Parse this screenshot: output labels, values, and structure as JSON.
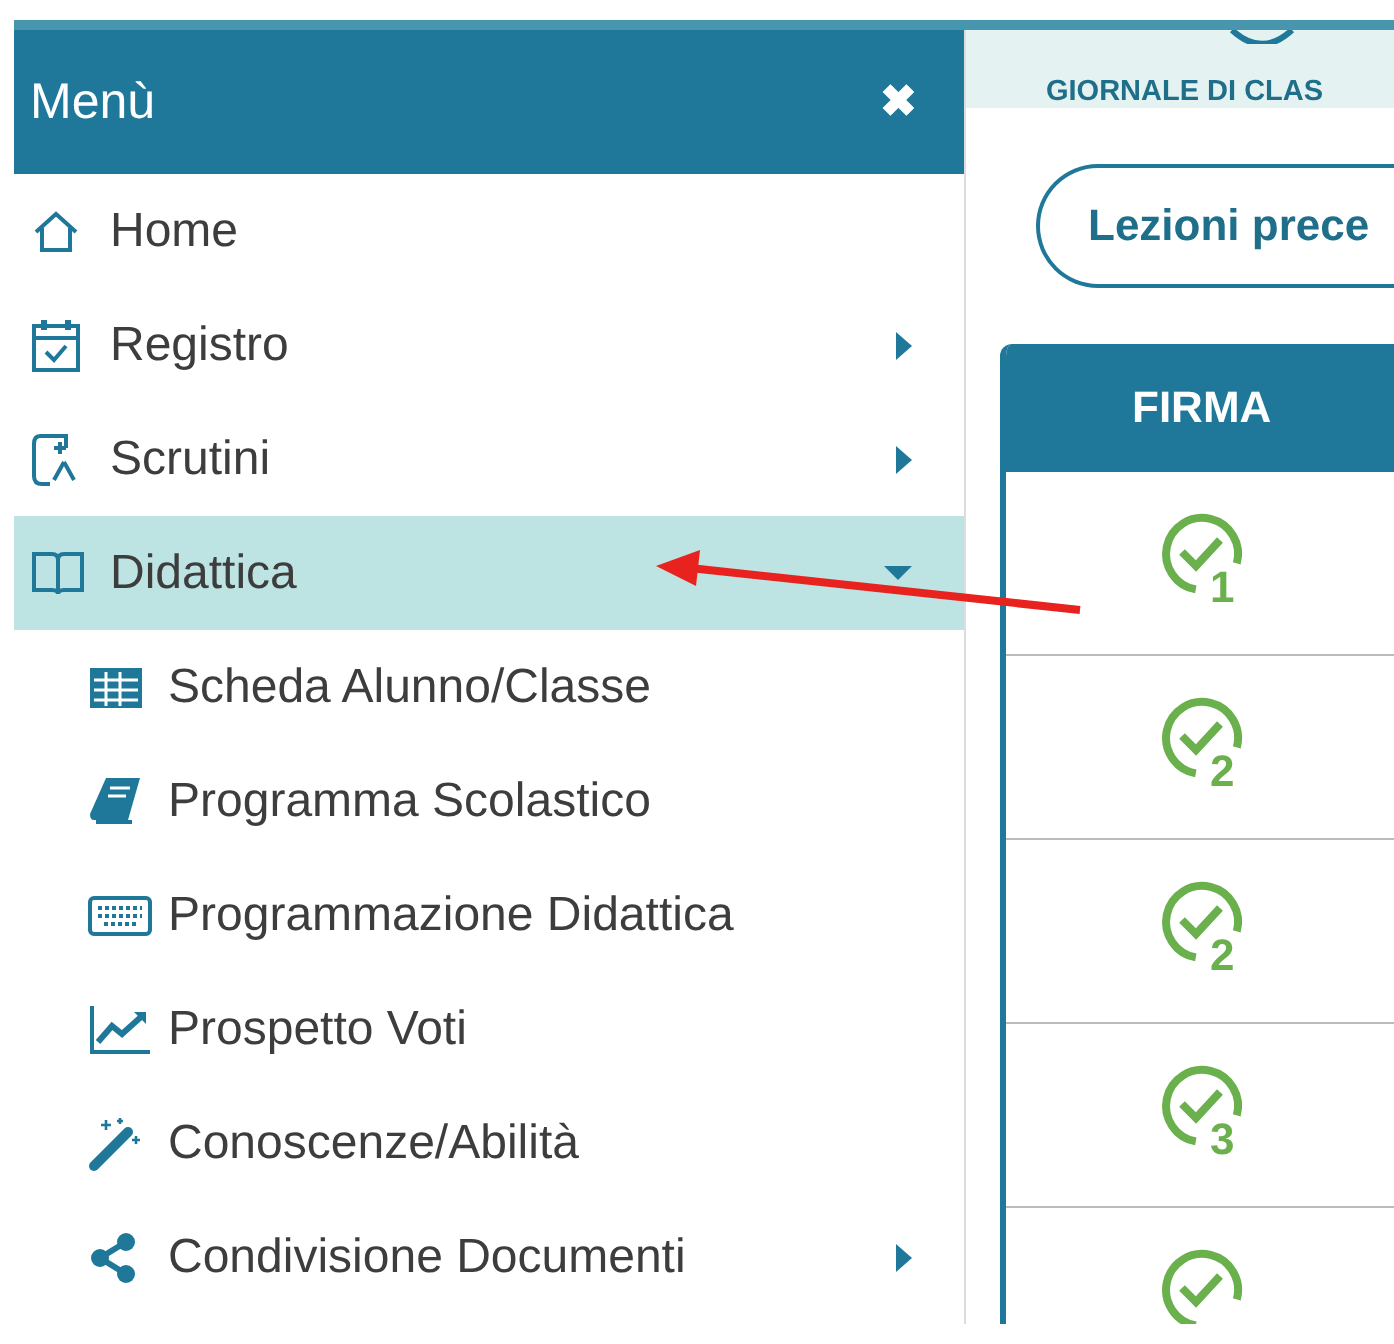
{
  "menu": {
    "title": "Menù",
    "close": "✖",
    "items": [
      {
        "label": "Home",
        "selected": false
      },
      {
        "label": "Registro",
        "expanded": false,
        "selected": false
      },
      {
        "label": "Scrutini",
        "expanded": false,
        "selected": false
      },
      {
        "label": "Didattica",
        "expanded": true,
        "selected": true,
        "children": [
          {
            "label": "Scheda Alunno/Classe"
          },
          {
            "label": "Programma Scolastico"
          },
          {
            "label": "Programmazione Didattica"
          },
          {
            "label": "Prospetto Voti"
          },
          {
            "label": "Conoscenze/Abilità"
          },
          {
            "label": "Condivisione Documenti",
            "expanded": false
          }
        ]
      }
    ]
  },
  "main": {
    "section_title": "GIORNALE DI CLAS",
    "button": "Lezioni prece",
    "table": {
      "columns": [
        "FIRMA"
      ],
      "rows": [
        {
          "signed": true,
          "count": "1"
        },
        {
          "signed": true,
          "count": "2"
        },
        {
          "signed": true,
          "count": "2"
        },
        {
          "signed": true,
          "count": "3"
        },
        {
          "signed": true
        }
      ]
    }
  }
}
